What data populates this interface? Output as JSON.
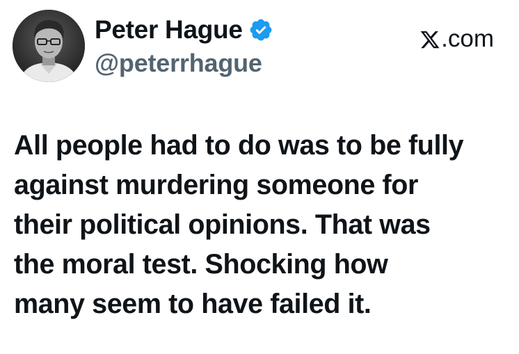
{
  "author": {
    "display_name": "Peter Hague",
    "handle": "@peterrhague",
    "verified": true,
    "avatar_icon": "person-portrait-icon",
    "verified_icon": "verified-badge-icon"
  },
  "source": {
    "label": ".com",
    "logo_icon": "x-logo-icon"
  },
  "tweet": {
    "lines": [
      "All people had to do was to be fully",
      "against murdering someone for",
      "their political opinions. That was",
      "the moral test. Shocking how",
      "many seem to have failed it."
    ]
  },
  "colors": {
    "text": "#0f1419",
    "handle": "#536471",
    "verified_badge": "#1d9bf0",
    "background": "#ffffff"
  }
}
